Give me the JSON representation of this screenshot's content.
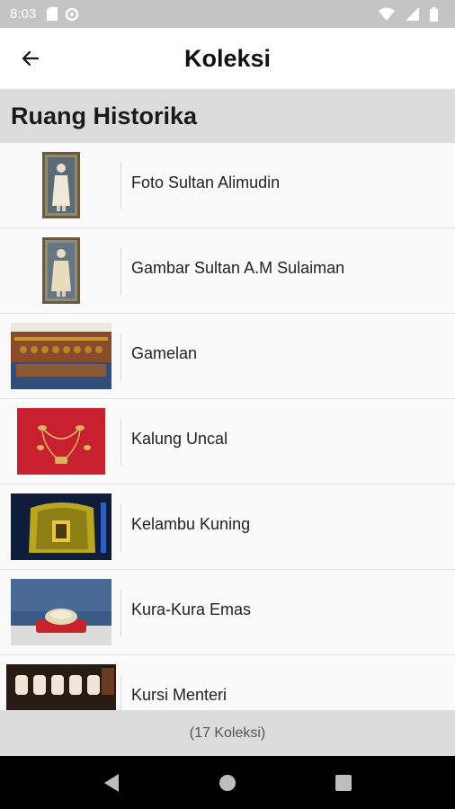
{
  "status_bar": {
    "time": "8:03",
    "icons": [
      "sd-card-icon",
      "data-saver-icon",
      "wifi-icon",
      "signal-icon",
      "battery-icon"
    ]
  },
  "app_bar": {
    "title": "Koleksi",
    "back_icon": "arrow-left-icon"
  },
  "section": {
    "title": "Ruang Historika"
  },
  "items": [
    {
      "label": "Foto Sultan Alimudin",
      "thumb": "portrait"
    },
    {
      "label": "Gambar Sultan A.M Sulaiman",
      "thumb": "portrait"
    },
    {
      "label": "Gamelan",
      "thumb": "gamelan"
    },
    {
      "label": "Kalung Uncal",
      "thumb": "necklace"
    },
    {
      "label": "Kelambu Kuning",
      "thumb": "canopy"
    },
    {
      "label": "Kura-Kura Emas",
      "thumb": "turtle"
    },
    {
      "label": "Kursi Menteri",
      "thumb": "chairs"
    }
  ],
  "footer": {
    "count_text": "(17 Koleksi)"
  },
  "nav_bar": {
    "icons": [
      "back-triangle-icon",
      "home-circle-icon",
      "recents-square-icon"
    ]
  },
  "colors": {
    "status_bar": "#c4c4c4",
    "section_header": "#dcdcdc",
    "footer": "#dcdcdc",
    "nav_bar": "#000000"
  }
}
